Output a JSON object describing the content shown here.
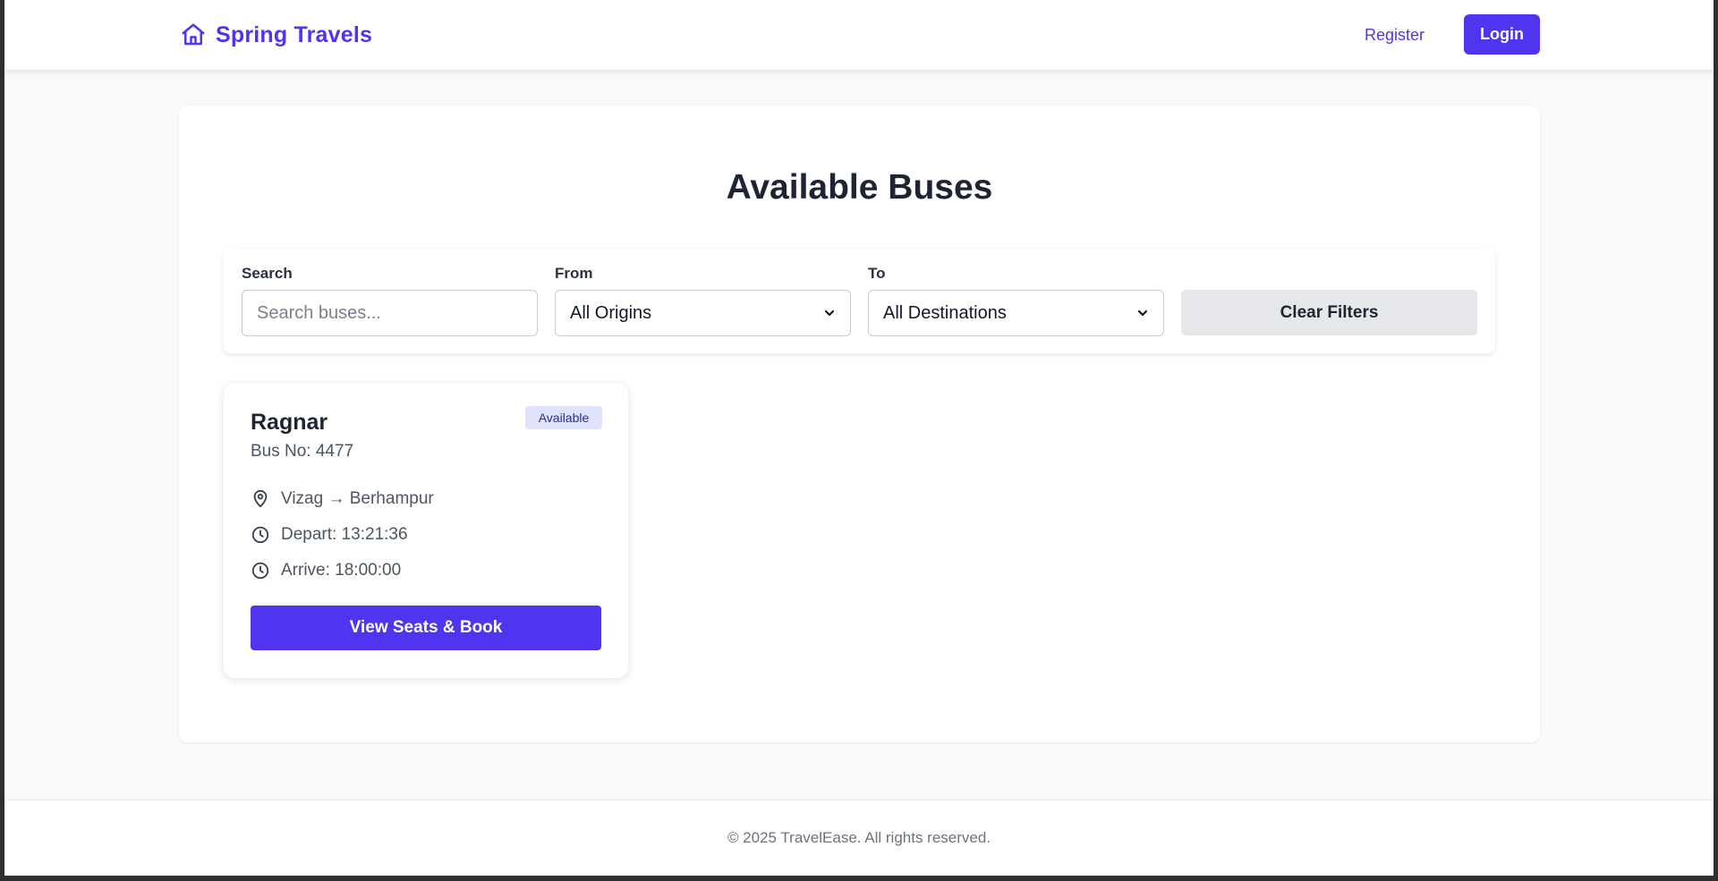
{
  "header": {
    "brand": "Spring Travels",
    "register": "Register",
    "login": "Login"
  },
  "main": {
    "title": "Available Buses",
    "filters": {
      "search_label": "Search",
      "search_placeholder": "Search buses...",
      "from_label": "From",
      "from_value": "All Origins",
      "to_label": "To",
      "to_value": "All Destinations",
      "clear": "Clear Filters"
    },
    "buses": [
      {
        "name": "Ragnar",
        "status": "Available",
        "bus_no": "Bus No: 4477",
        "route": "Vizag → Berhampur",
        "depart": "Depart: 13:21:36",
        "arrive": "Arrive: 18:00:00",
        "action": "View Seats & Book"
      }
    ]
  },
  "footer": {
    "text": "© 2025 TravelEase. All rights reserved."
  },
  "colors": {
    "accent": "#4f35f0",
    "badge_bg": "#e0e3fb",
    "page_bg": "#f8f9fb"
  },
  "icons": {
    "brand": "home-icon",
    "route": "map-pin-icon",
    "time": "clock-icon",
    "select": "chevron-down-icon"
  }
}
